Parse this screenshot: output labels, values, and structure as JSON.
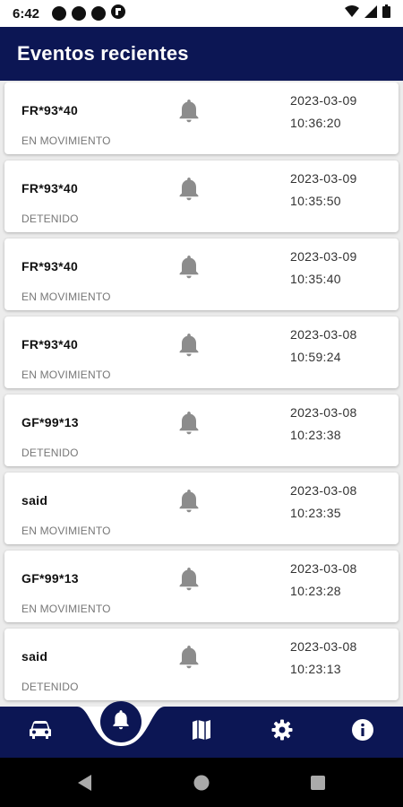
{
  "status_bar": {
    "time": "6:42"
  },
  "app_bar": {
    "title": "Eventos recientes"
  },
  "colors": {
    "primary": "#0c1654",
    "bell": "#8c8c8c"
  },
  "events": [
    {
      "plate": "FR*93*40",
      "status": "EN MOVIMIENTO",
      "date": "2023-03-09",
      "time": "10:36:20",
      "icon": "bell-icon"
    },
    {
      "plate": "FR*93*40",
      "status": "DETENIDO",
      "date": "2023-03-09",
      "time": "10:35:50",
      "icon": "bell-icon"
    },
    {
      "plate": "FR*93*40",
      "status": "EN MOVIMIENTO",
      "date": "2023-03-09",
      "time": "10:35:40",
      "icon": "bell-icon"
    },
    {
      "plate": "FR*93*40",
      "status": "EN MOVIMIENTO",
      "date": "2023-03-08",
      "time": "10:59:24",
      "icon": "bell-icon"
    },
    {
      "plate": "GF*99*13",
      "status": "DETENIDO",
      "date": "2023-03-08",
      "time": "10:23:38",
      "icon": "bell-icon"
    },
    {
      "plate": "said",
      "status": "EN MOVIMIENTO",
      "date": "2023-03-08",
      "time": "10:23:35",
      "icon": "bell-icon"
    },
    {
      "plate": "GF*99*13",
      "status": "EN MOVIMIENTO",
      "date": "2023-03-08",
      "time": "10:23:28",
      "icon": "bell-icon"
    },
    {
      "plate": "said",
      "status": "DETENIDO",
      "date": "2023-03-08",
      "time": "10:23:13",
      "icon": "bell-icon"
    }
  ],
  "bottom_nav": {
    "items": [
      {
        "icon": "car-icon",
        "active": false
      },
      {
        "icon": "bell-icon",
        "active": true
      },
      {
        "icon": "map-icon",
        "active": false
      },
      {
        "icon": "gear-icon",
        "active": false
      },
      {
        "icon": "info-icon",
        "active": false
      }
    ]
  },
  "system_nav": {
    "items": [
      "back-icon",
      "home-icon",
      "recents-icon"
    ]
  }
}
